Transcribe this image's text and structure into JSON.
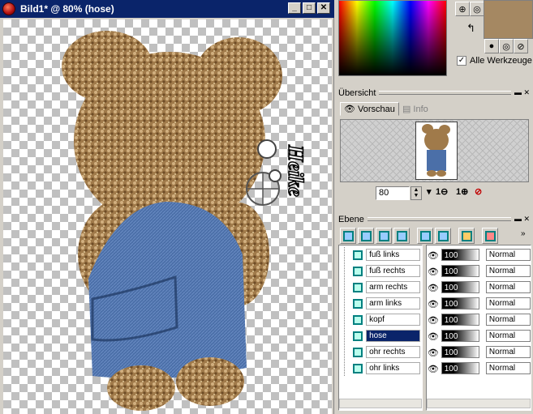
{
  "window": {
    "title": "Bild1* @ 80% (hose)",
    "minimize_label": "_",
    "maximize_label": "□",
    "close_label": "✕"
  },
  "colors": {
    "fg_swatch": "#a58862",
    "titlebar": "#0a246a",
    "selection": "#0a246a"
  },
  "color_panel": {
    "all_tools_label": "Alle Werkzeuge",
    "all_tools_checked": true
  },
  "overview": {
    "title": "Übersicht",
    "tabs": [
      {
        "label": "Vorschau",
        "active": true
      },
      {
        "label": "Info",
        "active": false
      }
    ],
    "zoom_value": "80"
  },
  "layers": {
    "title": "Ebene",
    "items": [
      {
        "name": "fuß links",
        "opacity": "100",
        "blend": "Normal",
        "selected": false
      },
      {
        "name": "fuß rechts",
        "opacity": "100",
        "blend": "Normal",
        "selected": false
      },
      {
        "name": "arm rechts",
        "opacity": "100",
        "blend": "Normal",
        "selected": false
      },
      {
        "name": "arm links",
        "opacity": "100",
        "blend": "Normal",
        "selected": false
      },
      {
        "name": "kopf",
        "opacity": "100",
        "blend": "Normal",
        "selected": false
      },
      {
        "name": "hose",
        "opacity": "100",
        "blend": "Normal",
        "selected": true
      },
      {
        "name": "ohr rechts",
        "opacity": "100",
        "blend": "Normal",
        "selected": false
      },
      {
        "name": "ohr links",
        "opacity": "100",
        "blend": "Normal",
        "selected": false
      }
    ]
  },
  "watermark": {
    "text": "Heike"
  }
}
